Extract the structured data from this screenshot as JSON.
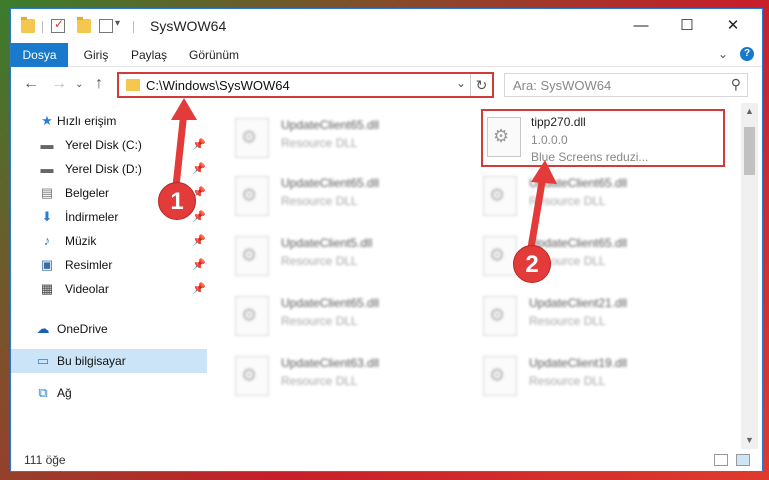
{
  "window": {
    "title": "SysWOW64"
  },
  "ribbon": {
    "tabs": [
      {
        "label": "Dosya"
      },
      {
        "label": "Giriş"
      },
      {
        "label": "Paylaş"
      },
      {
        "label": "Görünüm"
      }
    ],
    "help_label": "?"
  },
  "address": {
    "path": "C:\\Windows\\SysWOW64",
    "search_placeholder": "Ara: SysWOW64"
  },
  "sidebar": {
    "items": [
      {
        "label": "Hızlı erişim",
        "icon": "star-icon"
      },
      {
        "label": "Yerel Disk (C:)",
        "icon": "drive-icon",
        "pinned": true
      },
      {
        "label": "Yerel Disk (D:)",
        "icon": "drive-icon",
        "pinned": true
      },
      {
        "label": "Belgeler",
        "icon": "documents-icon",
        "pinned": true
      },
      {
        "label": "İndirmeler",
        "icon": "downloads-icon",
        "pinned": true
      },
      {
        "label": "Müzik",
        "icon": "music-icon",
        "pinned": true
      },
      {
        "label": "Resimler",
        "icon": "pictures-icon",
        "pinned": true
      },
      {
        "label": "Videolar",
        "icon": "videos-icon",
        "pinned": true
      },
      {
        "label": "OneDrive",
        "icon": "onedrive-icon"
      },
      {
        "label": "Bu bilgisayar",
        "icon": "computer-icon",
        "selected": true
      },
      {
        "label": "Ağ",
        "icon": "network-icon"
      }
    ]
  },
  "files": [
    {
      "name": "UpdateClient65.dll",
      "desc": "Resource DLL"
    },
    {
      "name": "tipp270.dll",
      "version": "1.0.0.0",
      "desc": "Blue Screens reduzi..."
    },
    {
      "name": "UpdateClient65.dll",
      "desc": "Resource DLL"
    },
    {
      "name": "UpdateClient65.dll",
      "desc": "Resource DLL"
    },
    {
      "name": "UpdateClient5.dll",
      "desc": "Resource DLL"
    },
    {
      "name": "UpdateClient65.dll",
      "desc": "Resource DLL"
    },
    {
      "name": "UpdateClient65.dll",
      "desc": "Resource DLL"
    },
    {
      "name": "UpdateClient21.dll",
      "desc": "Resource DLL"
    },
    {
      "name": "UpdateClient63.dll",
      "desc": "Resource DLL"
    },
    {
      "name": "UpdateClient19.dll",
      "desc": "Resource DLL"
    }
  ],
  "status": {
    "count_text": "111 öğe"
  },
  "annotations": [
    {
      "number": "1"
    },
    {
      "number": "2"
    }
  ],
  "colors": {
    "accent": "#1979ca",
    "highlight": "#d33b3b"
  }
}
